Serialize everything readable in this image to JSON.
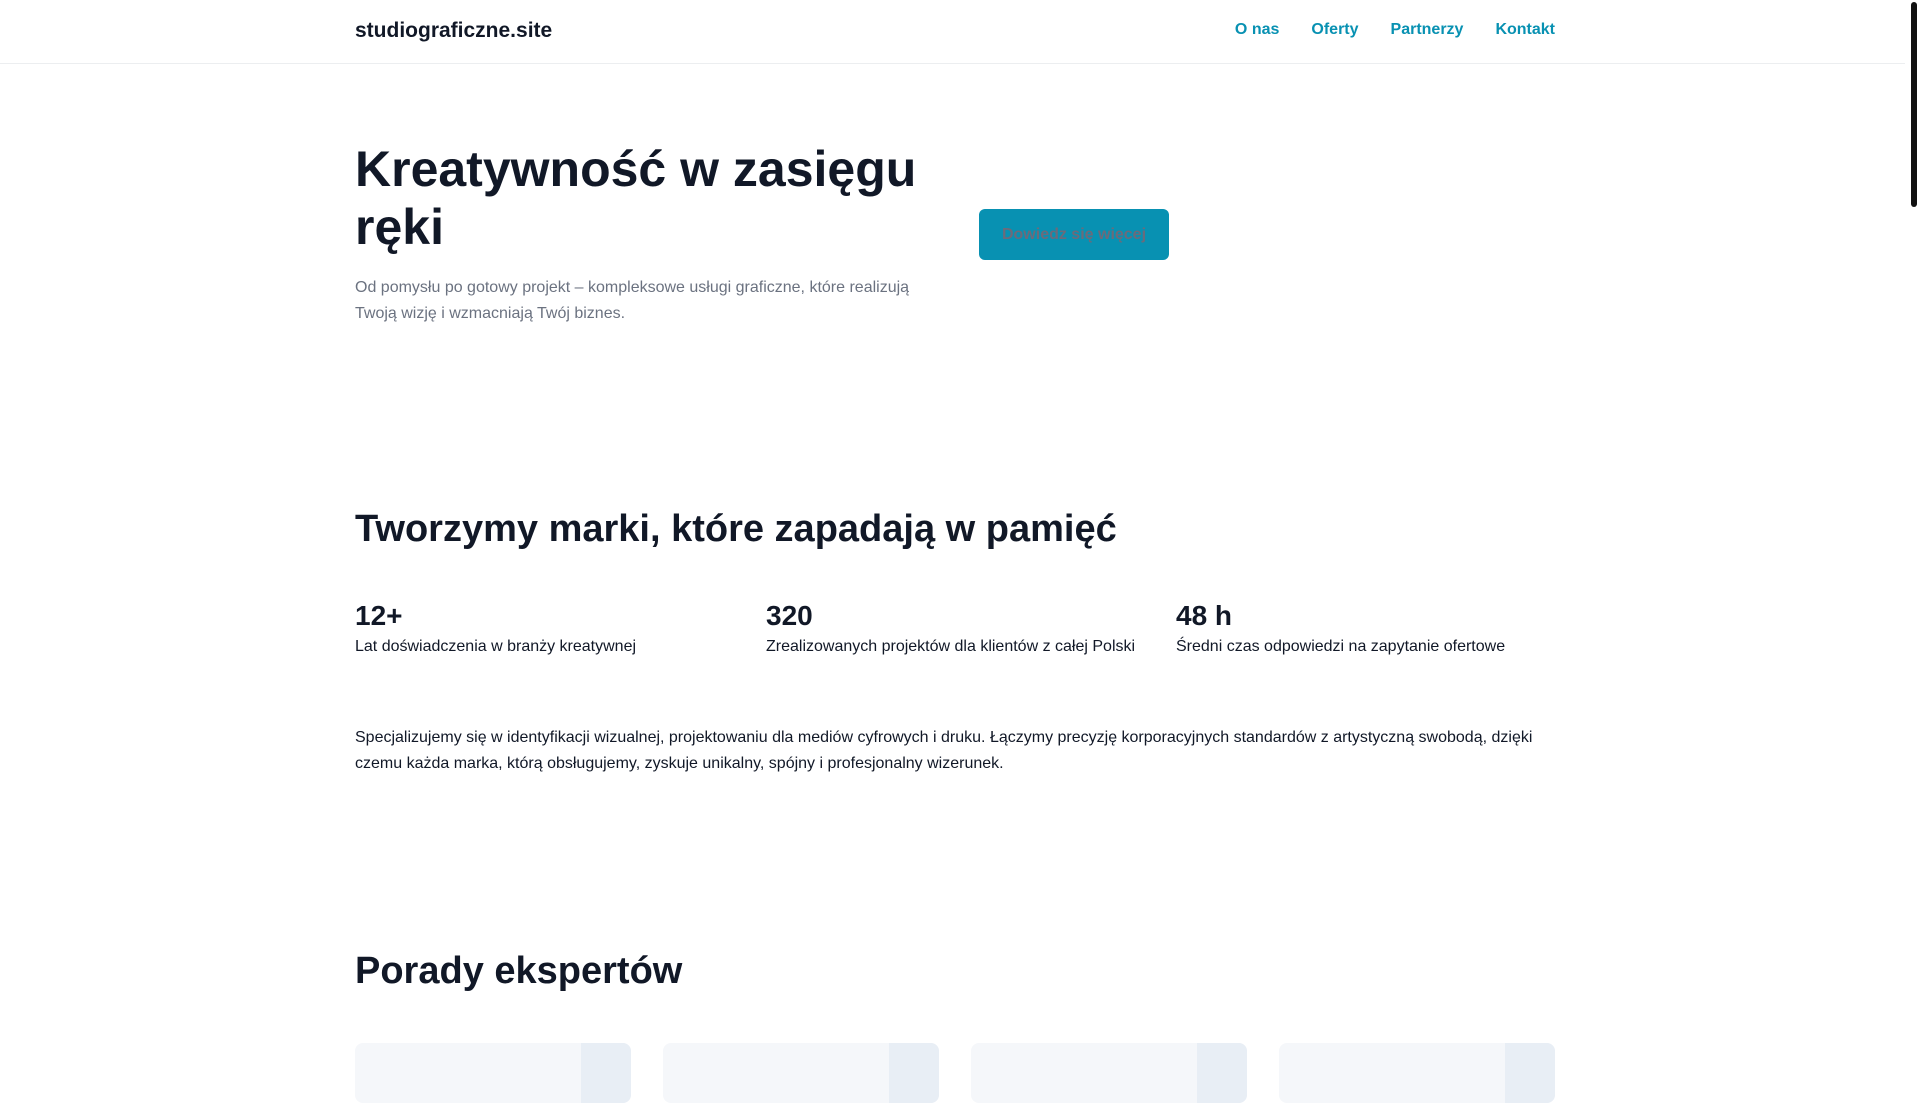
{
  "header": {
    "logo": "studiograficzne.site",
    "nav": [
      "O nas",
      "Oferty",
      "Partnerzy",
      "Kontakt"
    ]
  },
  "hero": {
    "title": "Kreatywność w zasięgu ręki",
    "text": "Od pomysłu po gotowy projekt – kompleksowe usługi graficzne, które realizują Twoją wizję i wzmacniają Twój biznes.",
    "cta": "Dowiedz się więcej"
  },
  "about": {
    "title": "Tworzymy marki, które zapadają w pamięć",
    "stats": [
      {
        "num": "12+",
        "label": "Lat doświadczenia w branży kreatywnej"
      },
      {
        "num": "320",
        "label": "Zrealizowanych projektów dla klientów z całej Polski"
      },
      {
        "num": "48 h",
        "label": "Średni czas odpowiedzi na zapytanie ofertowe"
      }
    ],
    "text": "Specjalizujemy się w identyfikacji wizualnej, projektowaniu dla mediów cyfrowych i druku. Łączymy precyzję korporacyjnych standardów z artystyczną swobodą, dzięki czemu każda marka, którą obsługujemy, zyskuje unikalny, spójny i profesjonalny wizerunek."
  },
  "advice": {
    "title": "Porady ekspertów"
  },
  "colors": {
    "accent": "#0891b2",
    "text": "#111827",
    "muted": "#6b7280"
  }
}
